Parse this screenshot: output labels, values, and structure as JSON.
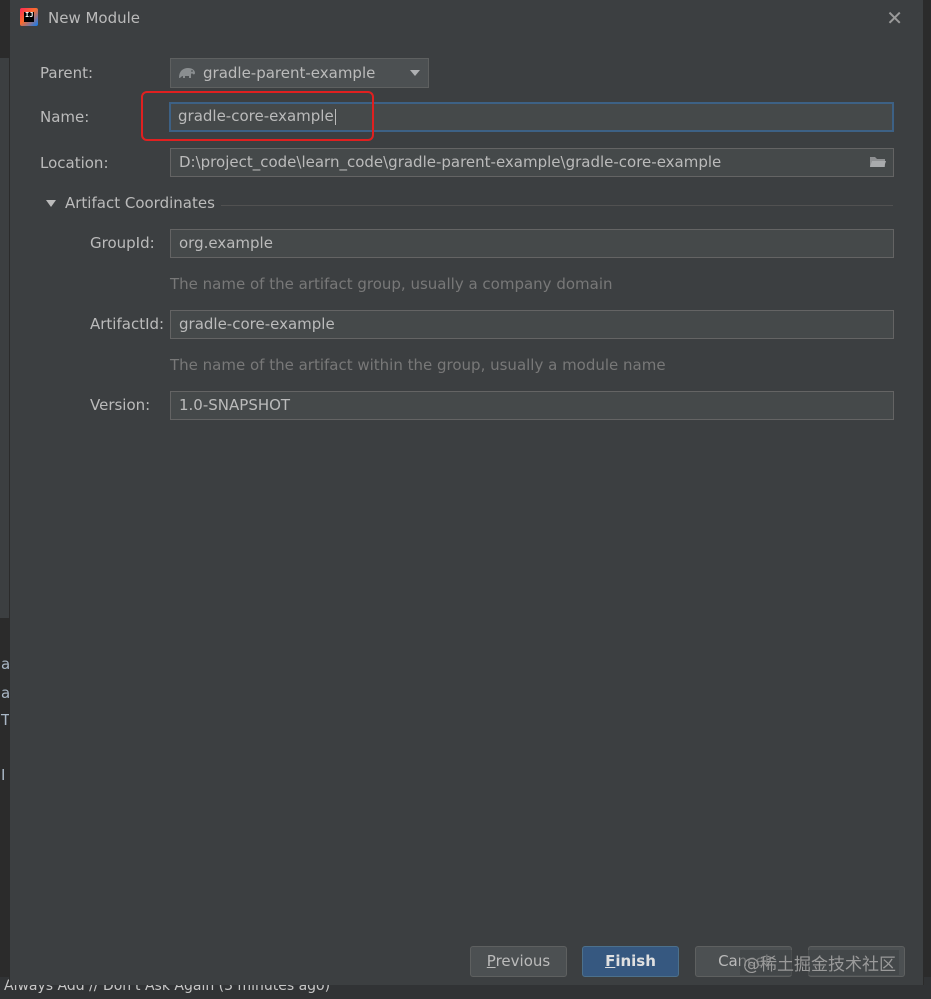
{
  "dialog": {
    "title": "New Module",
    "close_glyph": "✕"
  },
  "form": {
    "parent_label": "Parent:",
    "parent_value": "gradle-parent-example",
    "name_label": "Name:",
    "name_value": "gradle-core-example",
    "location_label": "Location:",
    "location_value": "D:\\project_code\\learn_code\\gradle-parent-example\\gradle-core-example"
  },
  "artifact": {
    "section_title": "Artifact Coordinates",
    "groupid_label": "GroupId:",
    "groupid_value": "org.example",
    "groupid_hint": "The name of the artifact group, usually a company domain",
    "artifactid_label": "ArtifactId:",
    "artifactid_value": "gradle-core-example",
    "artifactid_hint": "The name of the artifact within the group, usually a module name",
    "version_label": "Version:",
    "version_value": "1.0-SNAPSHOT"
  },
  "buttons": {
    "previous_first": "P",
    "previous_rest": "revious",
    "finish_first": "F",
    "finish_rest": "inish",
    "cancel": "Cancel"
  },
  "watermark": "@稀土掘金技术社区",
  "background": {
    "footer_text": "Always Add // Don't Ask Again (3 minutes ago)",
    "side_chars": [
      "a",
      "a",
      "T",
      "I"
    ]
  },
  "colors": {
    "dialog_bg": "#3c3f41",
    "field_bg": "#45494a",
    "primary_button": "#365880",
    "highlight_box": "#e02020"
  },
  "icons": [
    "intellij-app-icon",
    "close-icon",
    "gradle-elephant-icon",
    "chevron-down-icon",
    "folder-icon",
    "collapse-triangle-icon"
  ]
}
